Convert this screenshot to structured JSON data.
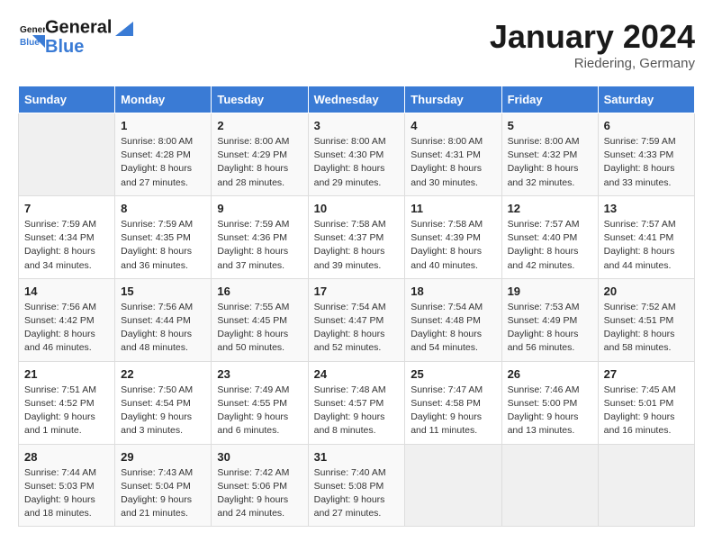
{
  "logo": {
    "general": "General",
    "blue": "Blue"
  },
  "title": "January 2024",
  "location": "Riedering, Germany",
  "days_of_week": [
    "Sunday",
    "Monday",
    "Tuesday",
    "Wednesday",
    "Thursday",
    "Friday",
    "Saturday"
  ],
  "weeks": [
    [
      {
        "day": "",
        "sunrise": "",
        "sunset": "",
        "daylight": ""
      },
      {
        "day": "1",
        "sunrise": "Sunrise: 8:00 AM",
        "sunset": "Sunset: 4:28 PM",
        "daylight": "Daylight: 8 hours and 27 minutes."
      },
      {
        "day": "2",
        "sunrise": "Sunrise: 8:00 AM",
        "sunset": "Sunset: 4:29 PM",
        "daylight": "Daylight: 8 hours and 28 minutes."
      },
      {
        "day": "3",
        "sunrise": "Sunrise: 8:00 AM",
        "sunset": "Sunset: 4:30 PM",
        "daylight": "Daylight: 8 hours and 29 minutes."
      },
      {
        "day": "4",
        "sunrise": "Sunrise: 8:00 AM",
        "sunset": "Sunset: 4:31 PM",
        "daylight": "Daylight: 8 hours and 30 minutes."
      },
      {
        "day": "5",
        "sunrise": "Sunrise: 8:00 AM",
        "sunset": "Sunset: 4:32 PM",
        "daylight": "Daylight: 8 hours and 32 minutes."
      },
      {
        "day": "6",
        "sunrise": "Sunrise: 7:59 AM",
        "sunset": "Sunset: 4:33 PM",
        "daylight": "Daylight: 8 hours and 33 minutes."
      }
    ],
    [
      {
        "day": "7",
        "sunrise": "Sunrise: 7:59 AM",
        "sunset": "Sunset: 4:34 PM",
        "daylight": "Daylight: 8 hours and 34 minutes."
      },
      {
        "day": "8",
        "sunrise": "Sunrise: 7:59 AM",
        "sunset": "Sunset: 4:35 PM",
        "daylight": "Daylight: 8 hours and 36 minutes."
      },
      {
        "day": "9",
        "sunrise": "Sunrise: 7:59 AM",
        "sunset": "Sunset: 4:36 PM",
        "daylight": "Daylight: 8 hours and 37 minutes."
      },
      {
        "day": "10",
        "sunrise": "Sunrise: 7:58 AM",
        "sunset": "Sunset: 4:37 PM",
        "daylight": "Daylight: 8 hours and 39 minutes."
      },
      {
        "day": "11",
        "sunrise": "Sunrise: 7:58 AM",
        "sunset": "Sunset: 4:39 PM",
        "daylight": "Daylight: 8 hours and 40 minutes."
      },
      {
        "day": "12",
        "sunrise": "Sunrise: 7:57 AM",
        "sunset": "Sunset: 4:40 PM",
        "daylight": "Daylight: 8 hours and 42 minutes."
      },
      {
        "day": "13",
        "sunrise": "Sunrise: 7:57 AM",
        "sunset": "Sunset: 4:41 PM",
        "daylight": "Daylight: 8 hours and 44 minutes."
      }
    ],
    [
      {
        "day": "14",
        "sunrise": "Sunrise: 7:56 AM",
        "sunset": "Sunset: 4:42 PM",
        "daylight": "Daylight: 8 hours and 46 minutes."
      },
      {
        "day": "15",
        "sunrise": "Sunrise: 7:56 AM",
        "sunset": "Sunset: 4:44 PM",
        "daylight": "Daylight: 8 hours and 48 minutes."
      },
      {
        "day": "16",
        "sunrise": "Sunrise: 7:55 AM",
        "sunset": "Sunset: 4:45 PM",
        "daylight": "Daylight: 8 hours and 50 minutes."
      },
      {
        "day": "17",
        "sunrise": "Sunrise: 7:54 AM",
        "sunset": "Sunset: 4:47 PM",
        "daylight": "Daylight: 8 hours and 52 minutes."
      },
      {
        "day": "18",
        "sunrise": "Sunrise: 7:54 AM",
        "sunset": "Sunset: 4:48 PM",
        "daylight": "Daylight: 8 hours and 54 minutes."
      },
      {
        "day": "19",
        "sunrise": "Sunrise: 7:53 AM",
        "sunset": "Sunset: 4:49 PM",
        "daylight": "Daylight: 8 hours and 56 minutes."
      },
      {
        "day": "20",
        "sunrise": "Sunrise: 7:52 AM",
        "sunset": "Sunset: 4:51 PM",
        "daylight": "Daylight: 8 hours and 58 minutes."
      }
    ],
    [
      {
        "day": "21",
        "sunrise": "Sunrise: 7:51 AM",
        "sunset": "Sunset: 4:52 PM",
        "daylight": "Daylight: 9 hours and 1 minute."
      },
      {
        "day": "22",
        "sunrise": "Sunrise: 7:50 AM",
        "sunset": "Sunset: 4:54 PM",
        "daylight": "Daylight: 9 hours and 3 minutes."
      },
      {
        "day": "23",
        "sunrise": "Sunrise: 7:49 AM",
        "sunset": "Sunset: 4:55 PM",
        "daylight": "Daylight: 9 hours and 6 minutes."
      },
      {
        "day": "24",
        "sunrise": "Sunrise: 7:48 AM",
        "sunset": "Sunset: 4:57 PM",
        "daylight": "Daylight: 9 hours and 8 minutes."
      },
      {
        "day": "25",
        "sunrise": "Sunrise: 7:47 AM",
        "sunset": "Sunset: 4:58 PM",
        "daylight": "Daylight: 9 hours and 11 minutes."
      },
      {
        "day": "26",
        "sunrise": "Sunrise: 7:46 AM",
        "sunset": "Sunset: 5:00 PM",
        "daylight": "Daylight: 9 hours and 13 minutes."
      },
      {
        "day": "27",
        "sunrise": "Sunrise: 7:45 AM",
        "sunset": "Sunset: 5:01 PM",
        "daylight": "Daylight: 9 hours and 16 minutes."
      }
    ],
    [
      {
        "day": "28",
        "sunrise": "Sunrise: 7:44 AM",
        "sunset": "Sunset: 5:03 PM",
        "daylight": "Daylight: 9 hours and 18 minutes."
      },
      {
        "day": "29",
        "sunrise": "Sunrise: 7:43 AM",
        "sunset": "Sunset: 5:04 PM",
        "daylight": "Daylight: 9 hours and 21 minutes."
      },
      {
        "day": "30",
        "sunrise": "Sunrise: 7:42 AM",
        "sunset": "Sunset: 5:06 PM",
        "daylight": "Daylight: 9 hours and 24 minutes."
      },
      {
        "day": "31",
        "sunrise": "Sunrise: 7:40 AM",
        "sunset": "Sunset: 5:08 PM",
        "daylight": "Daylight: 9 hours and 27 minutes."
      },
      {
        "day": "",
        "sunrise": "",
        "sunset": "",
        "daylight": ""
      },
      {
        "day": "",
        "sunrise": "",
        "sunset": "",
        "daylight": ""
      },
      {
        "day": "",
        "sunrise": "",
        "sunset": "",
        "daylight": ""
      }
    ]
  ]
}
